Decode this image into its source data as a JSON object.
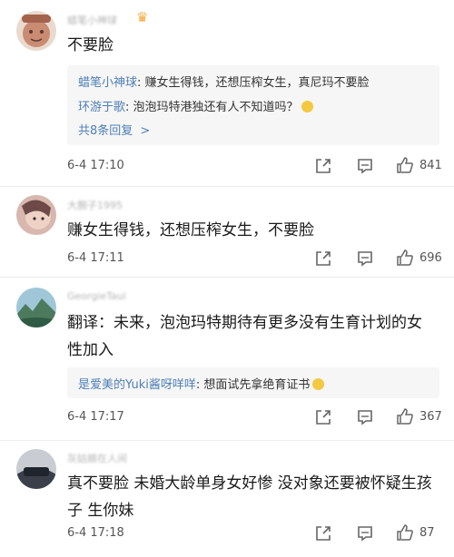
{
  "comments": [
    {
      "username": "蜡笔小神球",
      "text": "不要脸",
      "replies": [
        {
          "user": "蜡笔小神球",
          "content": ": 赚女生得钱，还想压榨女生，真尼玛不要脸"
        },
        {
          "user": "环游于歌",
          "content": ": 泡泡玛特港独还有人不知道吗？"
        }
      ],
      "more_replies": "共8条回复",
      "more_replies_arrow": ">",
      "time": "6-4 17:10",
      "likes": "841"
    },
    {
      "username": "大腕子1995",
      "text": "赚女生得钱，还想压榨女生，不要脸",
      "time": "6-4 17:11",
      "likes": "696"
    },
    {
      "username": "GeorgieTaui",
      "text": "翻译：未来，泡泡玛特期待有更多没有生育计划的女性加入",
      "replies": [
        {
          "user": "是爱美的Yuki酱呀咩咩",
          "content": ": 想面试先拿绝育证书"
        }
      ],
      "time": "6-4 17:17",
      "likes": "367"
    },
    {
      "username": "灰姑娘在人间",
      "text": "真不要脸 未婚大龄单身女好惨 没对象还要被怀疑生孩子 生你妹",
      "time": "6-4 17:18",
      "likes": "87"
    }
  ],
  "icons": {
    "share": "share-icon",
    "comment": "comment-icon",
    "like": "thumbs-up-icon",
    "crown": "crown-icon"
  },
  "colors": {
    "link": "#4e7fb6",
    "muted": "#b5b5b5",
    "reply_bg": "#f6f6f6",
    "crown": "#f2a93b"
  }
}
